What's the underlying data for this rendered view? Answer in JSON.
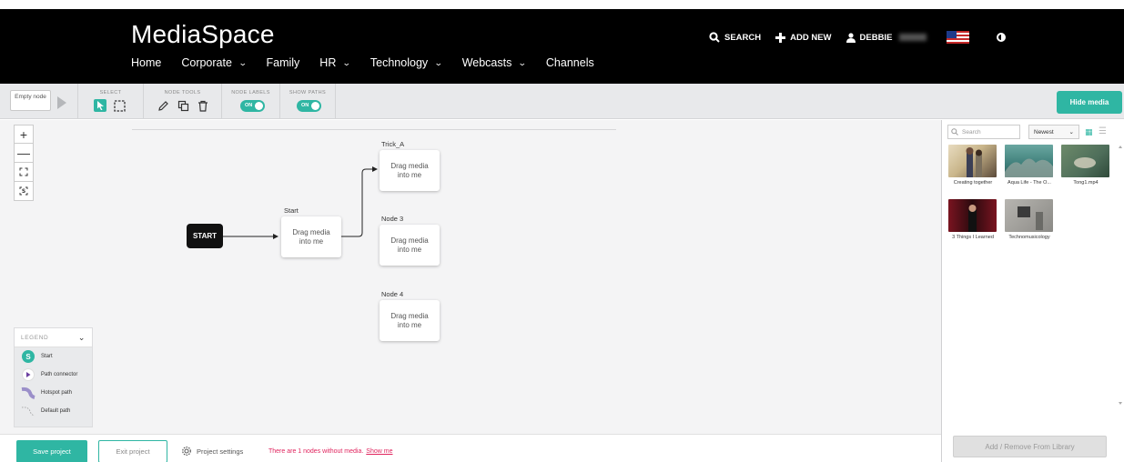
{
  "header": {
    "brand": "MediaSpace",
    "nav": [
      {
        "label": "Home",
        "dropdown": false
      },
      {
        "label": "Corporate",
        "dropdown": true
      },
      {
        "label": "Family",
        "dropdown": false
      },
      {
        "label": "HR",
        "dropdown": true
      },
      {
        "label": "Technology",
        "dropdown": true
      },
      {
        "label": "Webcasts",
        "dropdown": true
      },
      {
        "label": "Channels",
        "dropdown": false
      }
    ],
    "search_label": "SEARCH",
    "add_new_label": "ADD NEW",
    "user_label": "DEBBIE"
  },
  "toolbar": {
    "empty_node": "Empty node",
    "groups": {
      "select": "SELECT",
      "node_tools": "NODE TOOLS",
      "node_labels": "NODE LABELS",
      "show_paths": "SHOW PATHS"
    },
    "toggle_on": "ON",
    "hide_media": "Hide media"
  },
  "canvas": {
    "start_label": "START",
    "nodes": [
      {
        "title": "Start",
        "body": "Drag media into me"
      },
      {
        "title": "Trick_A",
        "body": "Drag media into me"
      },
      {
        "title": "Node 3",
        "body": "Drag media into me"
      },
      {
        "title": "Node 4",
        "body": "Drag media into me"
      }
    ]
  },
  "legend": {
    "title": "LEGEND",
    "items": [
      {
        "label": "Start",
        "icon": "start-badge-icon"
      },
      {
        "label": "Path connector",
        "icon": "path-connector-icon"
      },
      {
        "label": "Hotspot path",
        "icon": "hotspot-path-icon"
      },
      {
        "label": "Default path",
        "icon": "default-path-icon"
      }
    ]
  },
  "media": {
    "search_placeholder": "Search",
    "sort": "Newest",
    "items": [
      {
        "caption": "Creating together",
        "color": "#c9b58a"
      },
      {
        "caption": "Aqua Life - The O...",
        "color": "#4f8f8a"
      },
      {
        "caption": "Tong1.mp4",
        "color": "#4e6e5a"
      },
      {
        "caption": "3 Things I Learned",
        "color": "#7a1420"
      },
      {
        "caption": "Technomusicology",
        "color": "#8b8a86"
      }
    ],
    "add_remove": "Add / Remove From Library"
  },
  "footer": {
    "save": "Save project",
    "exit": "Exit project",
    "settings": "Project settings",
    "warning": "There are 1 nodes without media.",
    "show_me": "Show me"
  },
  "colors": {
    "accent": "#2fb6a3",
    "warning": "#e0245e",
    "header_bg": "#000000"
  }
}
